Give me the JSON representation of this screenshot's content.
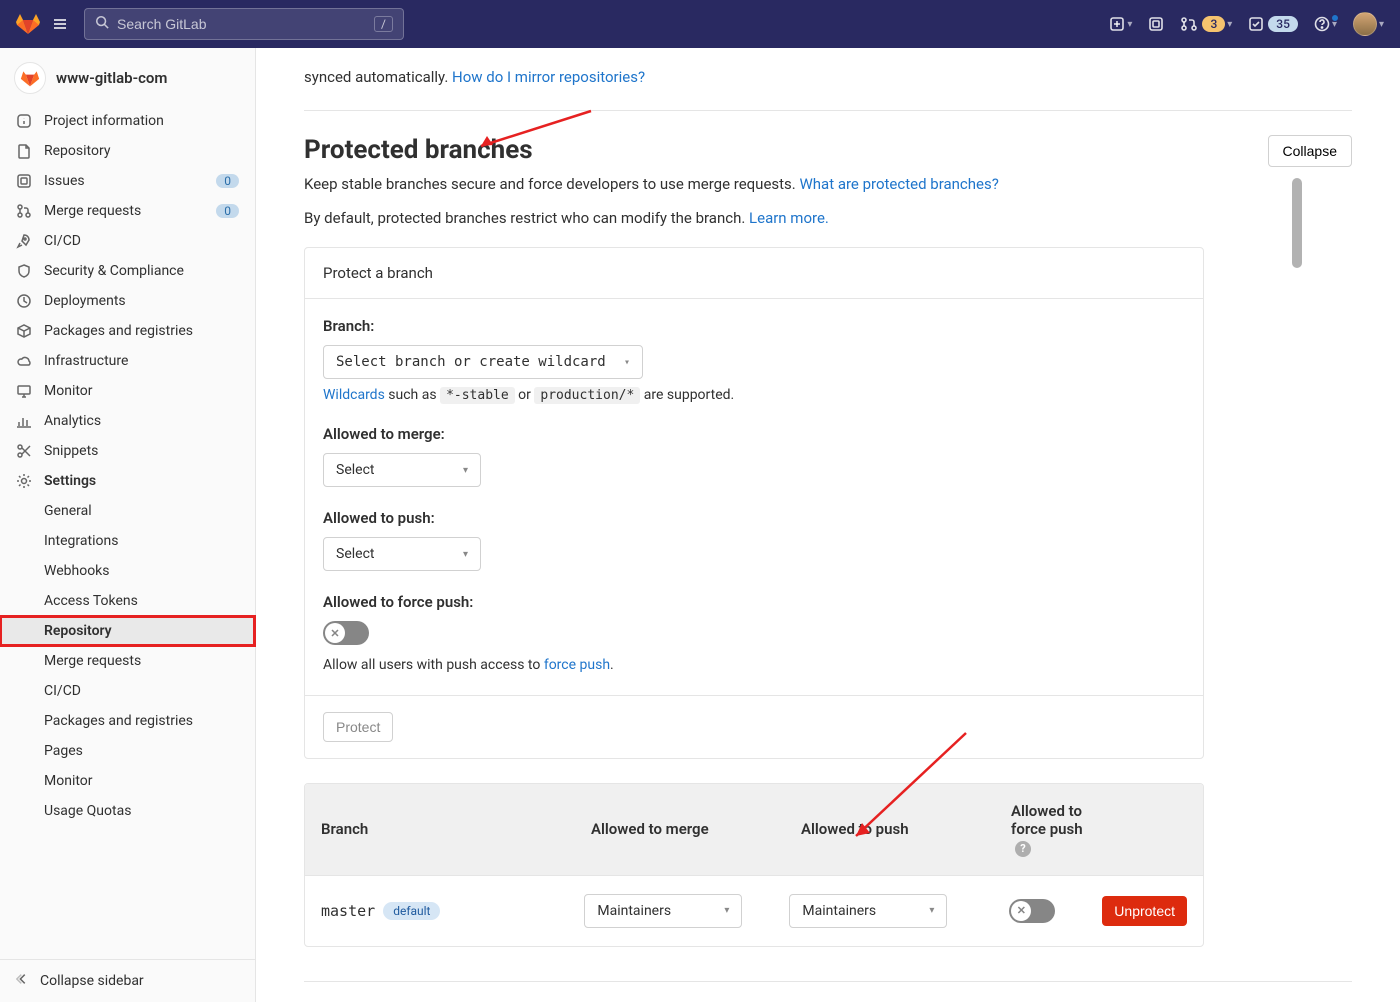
{
  "header": {
    "search_placeholder": "Search GitLab",
    "slash_hint": "/",
    "mr_badge": "3",
    "todos_badge": "35"
  },
  "project": {
    "name": "www-gitlab-com"
  },
  "sidebar": {
    "items": [
      {
        "label": "Project information"
      },
      {
        "label": "Repository"
      },
      {
        "label": "Issues",
        "badge": "0"
      },
      {
        "label": "Merge requests",
        "badge": "0"
      },
      {
        "label": "CI/CD"
      },
      {
        "label": "Security & Compliance"
      },
      {
        "label": "Deployments"
      },
      {
        "label": "Packages and registries"
      },
      {
        "label": "Infrastructure"
      },
      {
        "label": "Monitor"
      },
      {
        "label": "Analytics"
      },
      {
        "label": "Snippets"
      },
      {
        "label": "Settings"
      }
    ],
    "settings_sub": [
      {
        "label": "General"
      },
      {
        "label": "Integrations"
      },
      {
        "label": "Webhooks"
      },
      {
        "label": "Access Tokens"
      },
      {
        "label": "Repository"
      },
      {
        "label": "Merge requests"
      },
      {
        "label": "CI/CD"
      },
      {
        "label": "Packages and registries"
      },
      {
        "label": "Pages"
      },
      {
        "label": "Monitor"
      },
      {
        "label": "Usage Quotas"
      }
    ],
    "collapse_label": "Collapse sidebar"
  },
  "main": {
    "intro_prefix": "synced automatically. ",
    "intro_link": "How do I mirror repositories?",
    "section_title": "Protected branches",
    "collapse_button": "Collapse",
    "desc_text": "Keep stable branches secure and force developers to use merge requests. ",
    "desc_link": "What are protected branches?",
    "note_text": "By default, protected branches restrict who can modify the branch. ",
    "note_link": "Learn more.",
    "card": {
      "title": "Protect a branch",
      "branch_label": "Branch:",
      "branch_placeholder": "Select branch or create wildcard",
      "wildcards_link": "Wildcards",
      "wildcards_mid1": " such as ",
      "wildcards_code1": "*-stable",
      "wildcards_mid2": " or ",
      "wildcards_code2": "production/*",
      "wildcards_tail": " are supported.",
      "merge_label": "Allowed to merge:",
      "merge_value": "Select",
      "push_label": "Allowed to push:",
      "push_value": "Select",
      "force_label": "Allowed to force push:",
      "force_hint_prefix": "Allow all users with push access to ",
      "force_hint_link": "force push",
      "force_hint_suffix": ".",
      "protect_button": "Protect"
    },
    "table": {
      "col_branch": "Branch",
      "col_merge": "Allowed to merge",
      "col_push": "Allowed to push",
      "col_force": "Allowed to force push",
      "help_glyph": "?",
      "row": {
        "branch": "master",
        "default_badge": "default",
        "merge_value": "Maintainers",
        "push_value": "Maintainers",
        "unprotect": "Unprotect"
      }
    }
  }
}
